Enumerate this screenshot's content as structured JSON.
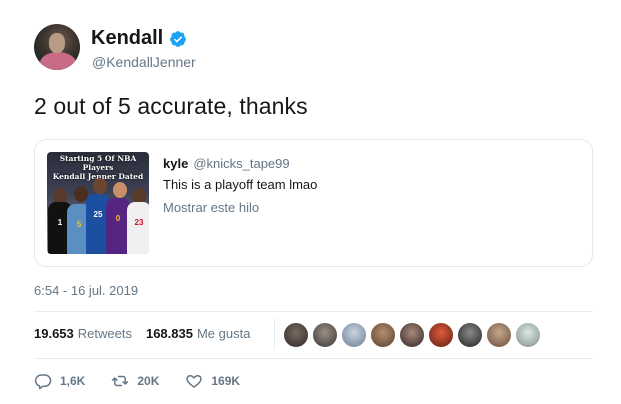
{
  "author": {
    "name": "Kendall",
    "handle": "@KendallJenner",
    "verified": true
  },
  "tweet": {
    "text": "2 out of 5 accurate, thanks",
    "timestamp": "6:54 - 16 jul. 2019"
  },
  "quote": {
    "thumb_title_line1": "Starting 5 Of NBA Players",
    "thumb_title_line2": "Kendall Jenner Dated",
    "jerseys": [
      "1",
      "5",
      "25",
      "0",
      "23"
    ],
    "author_name": "kyle",
    "author_handle": "@knicks_tape99",
    "text": "This is a playoff team lmao",
    "show_thread": "Mostrar este hilo"
  },
  "stats": {
    "retweets_count": "19.653",
    "retweets_label": "Retweets",
    "likes_count": "168.835",
    "likes_label": "Me gusta"
  },
  "actions": {
    "replies": "1,6K",
    "retweets": "20K",
    "likes": "169K"
  },
  "colors": {
    "verified": "#1da1f2",
    "secondary_text": "#657786",
    "border": "#e1e8ed"
  }
}
